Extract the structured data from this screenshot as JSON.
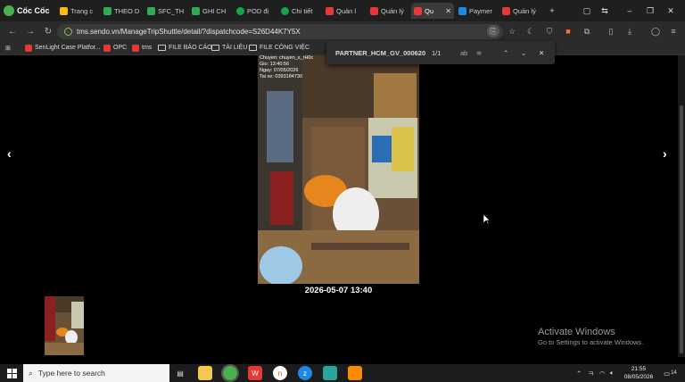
{
  "browser": {
    "brand": "Cốc Cốc",
    "tabs": [
      {
        "title": "Trang c",
        "color": "#fbbc05"
      },
      {
        "title": "THEO D",
        "color": "#34a853"
      },
      {
        "title": "SFC_TH",
        "color": "#34a853"
      },
      {
        "title": "GHI CH",
        "color": "#34a853"
      },
      {
        "title": "POD đị",
        "color": "#16a34a"
      },
      {
        "title": "Chi tiết",
        "color": "#16a34a"
      },
      {
        "title": "Quản l",
        "color": "#e53935"
      },
      {
        "title": "Quản lý",
        "color": "#e53935"
      },
      {
        "title": "Qu",
        "color": "#e53935"
      },
      {
        "title": "Paymer",
        "color": "#1e88e5"
      },
      {
        "title": "Quản lý",
        "color": "#e53935"
      }
    ],
    "new_tab": "+",
    "url": "tms.sendo.vn/ManageTripShuttle/detail/?dispatchcode=S26D44K7Y5X",
    "bookmarks": [
      {
        "label": "SenLight Case Platfor...",
        "kind": "site",
        "color": "#e53935"
      },
      {
        "label": "OPC",
        "kind": "site",
        "color": "#e53935"
      },
      {
        "label": "tms",
        "kind": "site",
        "color": "#e53935"
      },
      {
        "label": "FILE BÁO CÁO",
        "kind": "folder"
      },
      {
        "label": "TÀI LIỆU",
        "kind": "folder"
      },
      {
        "label": "FILE CÔNG VIỆC",
        "kind": "folder"
      }
    ],
    "find": {
      "query": "PARTNER_HCM_GV_000620",
      "count": "1/1"
    }
  },
  "viewer": {
    "prev_arrow": "‹",
    "next_arrow": "›",
    "photo_overlay": [
      "Chuyen: chuyen_s_rH0c",
      "Gio: 13:40:56",
      "Ngay: 07/05/2026",
      "Tai xe: 0393184730"
    ],
    "caption": "2026-05-07 13:40"
  },
  "watermark": {
    "title": "Activate Windows",
    "subtitle": "Go to Settings to activate Windows."
  },
  "taskbar": {
    "search_placeholder": "Type here to search",
    "time": "21:55",
    "date": "08/05/2026",
    "notification_count": "14"
  },
  "colors": {
    "accent": "#4caf50",
    "tab_active": "#3a3a3a",
    "toolbar": "#2b2b2b"
  }
}
